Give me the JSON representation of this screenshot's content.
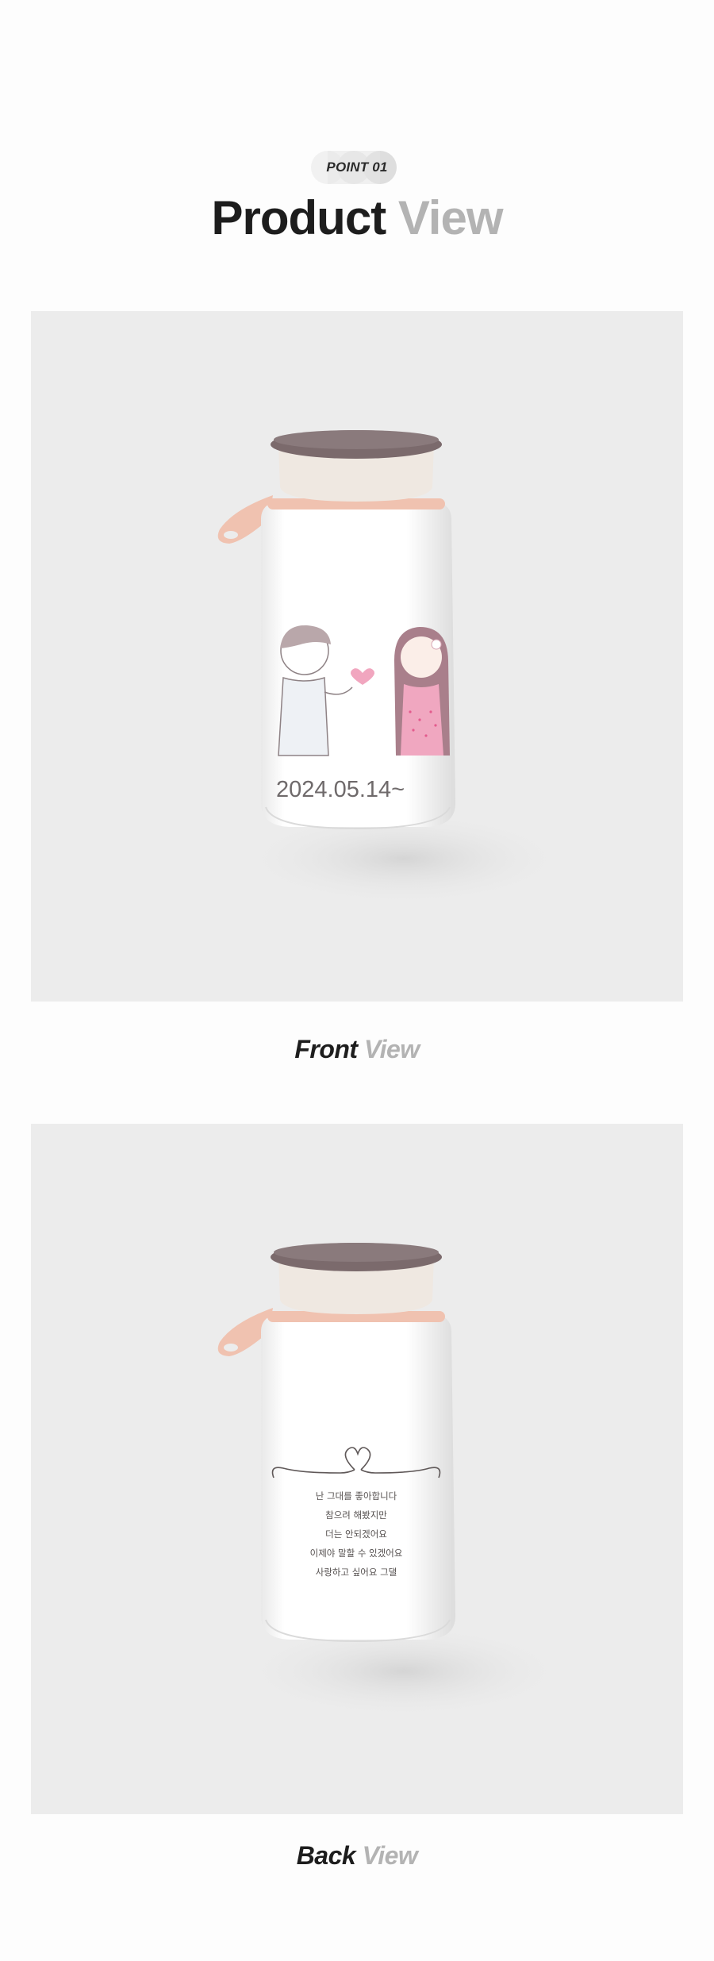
{
  "header": {
    "point_label": "POINT 01",
    "title_dark": "Product",
    "title_light": "View"
  },
  "front": {
    "caption_dark": "Front",
    "caption_light": "View",
    "date_text": "2024.05.14~"
  },
  "back": {
    "caption_dark": "Back",
    "caption_light": "View",
    "poem_lines": [
      "난 그대를 좋아합니다",
      "참으려 해봤지만",
      "더는 안되겠어요",
      "이제야 말할 수 있겠어요",
      "사랑하고 싶어요 그댈"
    ]
  },
  "colors": {
    "lid_top": "#7b6a6c",
    "lid_band": "#efe8e1",
    "strap": "#f0c2b0",
    "bottle": "#ffffff",
    "background_panel": "#ececec",
    "heart_pink": "#f1a6bf"
  }
}
